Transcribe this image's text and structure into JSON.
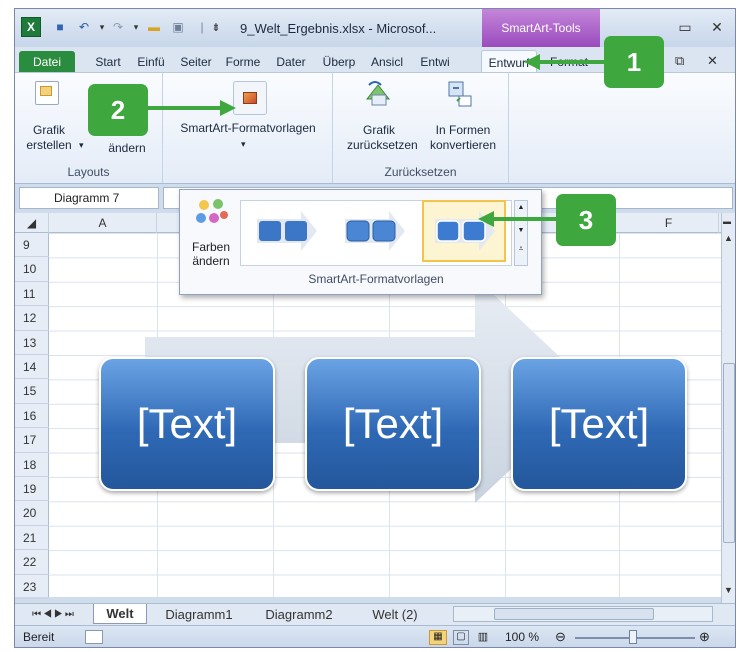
{
  "window": {
    "title": "9_Welt_Ergebnis.xlsx - Microsof...",
    "contextual_tab_group": "SmartArt-Tools"
  },
  "tabs": [
    "Datei",
    "Start",
    "Einfü",
    "Seiter",
    "Forme",
    "Dater",
    "Überp",
    "Ansicl",
    "Entwi",
    "Entwurf",
    "Format"
  ],
  "ribbon": {
    "grafik_erstellen": "Grafik\nerstellen",
    "grafik_erstellen_dd": "▾",
    "layouts_andern": "ändern",
    "layouts_group": "Layouts",
    "formatvorlagen_label": "SmartArt-Formatvorlagen",
    "grafik_zuruecksetzen": "Grafik\nzurücksetzen",
    "in_formen_konvertieren": "In Formen\nkonvertieren",
    "zuruecksetzen_group": "Zurücksetzen"
  },
  "namebox": {
    "value": "Diagramm 7"
  },
  "columns": [
    "A",
    "F"
  ],
  "rows": [
    "9",
    "10",
    "11",
    "12",
    "13",
    "14",
    "15",
    "16",
    "17",
    "18",
    "19",
    "20",
    "21",
    "22",
    "23"
  ],
  "smartart": {
    "boxes": [
      "[Text]",
      "[Text]",
      "[Text]"
    ]
  },
  "gallery_popup": {
    "farben_andern": "Farben\nändern",
    "group_label": "SmartArt-Formatvorlagen"
  },
  "sheet_tabs": [
    "Welt",
    "Diagramm1",
    "Diagramm2",
    "Welt (2)"
  ],
  "statusbar": {
    "ready": "Bereit",
    "zoom": "100 %"
  },
  "callouts": [
    "1",
    "2",
    "3"
  ],
  "colors": {
    "callout_green": "#3ea83f",
    "smartart_blue": "#2f69b5",
    "datei_tab": "#2a8c3e",
    "contextual": "#9a4bbd"
  }
}
